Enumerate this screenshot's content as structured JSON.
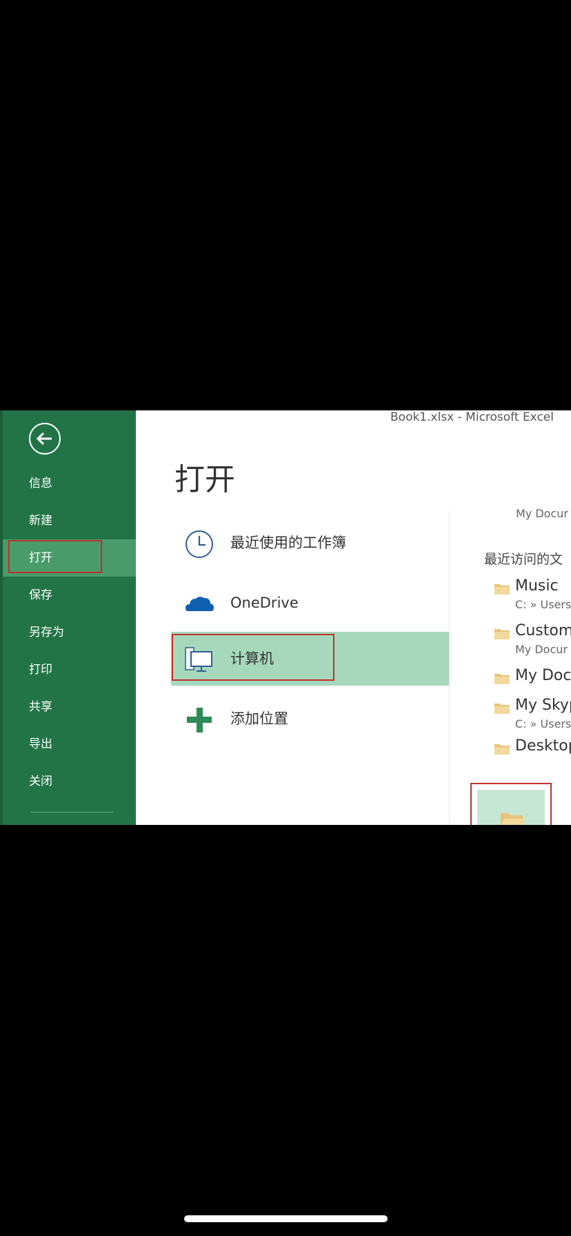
{
  "window": {
    "title": "Book1.xlsx - Microsoft Excel"
  },
  "page": {
    "title": "打开"
  },
  "sidebar": {
    "items": [
      {
        "label": "信息"
      },
      {
        "label": "新建"
      },
      {
        "label": "打开",
        "active": true
      },
      {
        "label": "保存"
      },
      {
        "label": "另存为"
      },
      {
        "label": "打印"
      },
      {
        "label": "共享"
      },
      {
        "label": "导出"
      },
      {
        "label": "关闭"
      }
    ],
    "colors": {
      "background": "#227447",
      "active": "#4a9b6a"
    }
  },
  "places": [
    {
      "label": "最近使用的工作簿",
      "icon": "clock-icon"
    },
    {
      "label": "OneDrive",
      "icon": "cloud-icon"
    },
    {
      "label": "计算机",
      "icon": "computer-icon",
      "selected": true
    },
    {
      "label": "添加位置",
      "icon": "plus-icon"
    }
  ],
  "right_panel": {
    "top_path": "My Docur",
    "heading": "最近访问的文",
    "folders": [
      {
        "name": "Music",
        "path": "C: » Users"
      },
      {
        "name": "Custom",
        "path": "My Docur"
      },
      {
        "name": "My Doc",
        "path": ""
      },
      {
        "name": "My Skyp",
        "path": "C: » Users"
      },
      {
        "name": "Desktop",
        "path": ""
      }
    ],
    "browse_icon": "folder-open-icon"
  },
  "highlight_color": "#c0302a",
  "accent_selected": "#a6d8bc"
}
